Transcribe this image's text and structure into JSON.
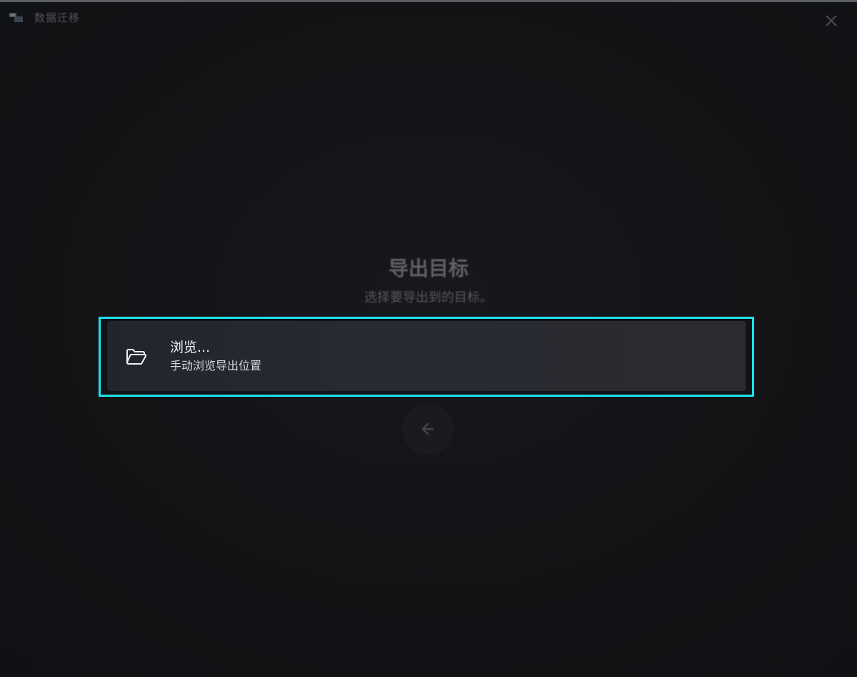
{
  "window": {
    "title": "数据迁移",
    "app_icon": "data-migration-icon",
    "close_icon": "close-icon"
  },
  "main": {
    "heading": "导出目标",
    "subheading": "选择要导出到的目标。"
  },
  "options": [
    {
      "icon": "folder-open-icon",
      "title": "浏览...",
      "description": "手动浏览导出位置"
    }
  ],
  "navigation": {
    "back_icon": "arrow-left-icon"
  },
  "colors": {
    "focus_outline": "#1fe3ee",
    "background": "#131316",
    "card": "#272a33"
  }
}
